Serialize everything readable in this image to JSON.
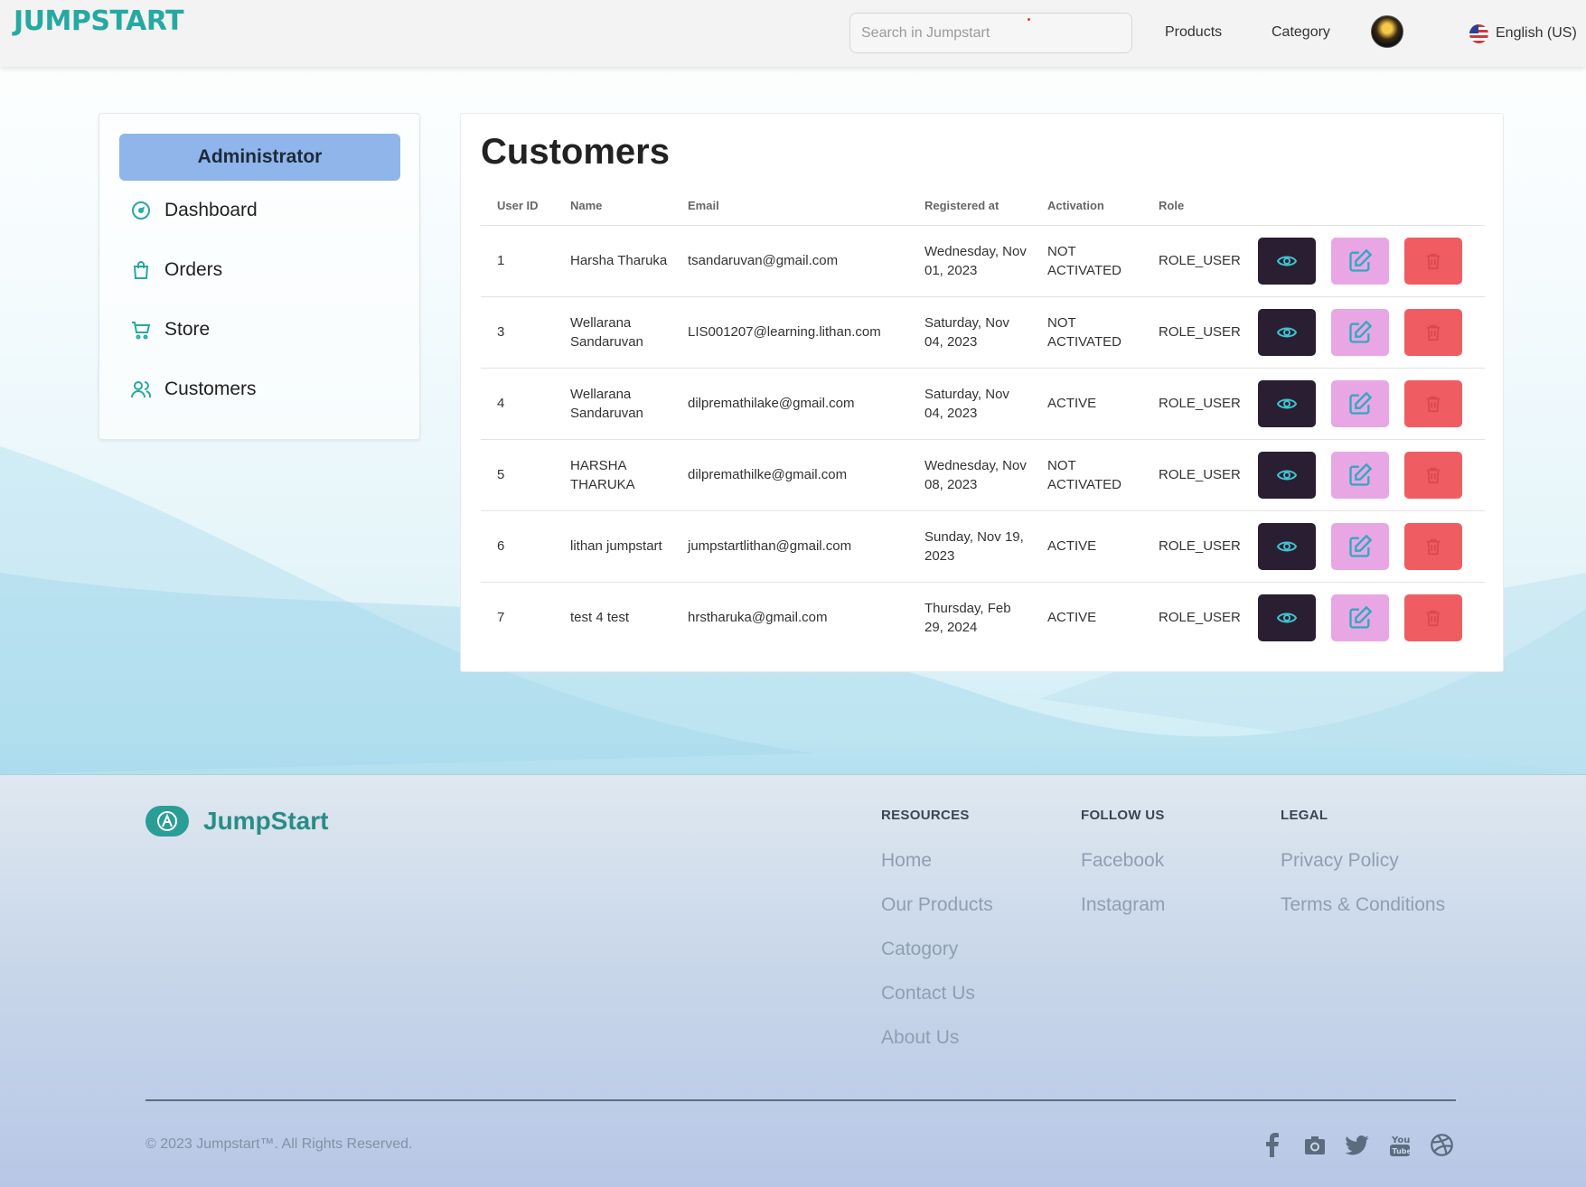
{
  "header": {
    "logo": "JUMPSTART",
    "search_placeholder": "Search in Jumpstart",
    "nav": [
      "Products",
      "Category"
    ],
    "language": "English (US)"
  },
  "sidebar": {
    "title": "Administrator",
    "items": [
      {
        "label": "Dashboard",
        "icon": "dashboard-gauge-icon"
      },
      {
        "label": "Orders",
        "icon": "shopping-bag-icon"
      },
      {
        "label": "Store",
        "icon": "cart-icon"
      },
      {
        "label": "Customers",
        "icon": "users-icon"
      }
    ]
  },
  "customers": {
    "title": "Customers",
    "columns": [
      "User ID",
      "Name",
      "Email",
      "Registered at",
      "Activation",
      "Role"
    ],
    "rows": [
      {
        "id": "1",
        "name": "Harsha Tharuka",
        "email": "tsandaruvan@gmail.com",
        "registered": "Wednesday, Nov 01, 2023",
        "activation": "NOT ACTIVATED",
        "role": "ROLE_USER"
      },
      {
        "id": "3",
        "name": "Wellarana Sandaruvan",
        "email": "LIS001207@learning.lithan.com",
        "registered": "Saturday, Nov 04, 2023",
        "activation": "NOT ACTIVATED",
        "role": "ROLE_USER"
      },
      {
        "id": "4",
        "name": "Wellarana Sandaruvan",
        "email": "dilpremathilake@gmail.com",
        "registered": "Saturday, Nov 04, 2023",
        "activation": "ACTIVE",
        "role": "ROLE_USER"
      },
      {
        "id": "5",
        "name": "HARSHA THARUKA",
        "email": "dilpremathilke@gmail.com",
        "registered": "Wednesday, Nov 08, 2023",
        "activation": "NOT ACTIVATED",
        "role": "ROLE_USER"
      },
      {
        "id": "6",
        "name": "lithan jumpstart",
        "email": "jumpstartlithan@gmail.com",
        "registered": "Sunday, Nov 19, 2023",
        "activation": "ACTIVE",
        "role": "ROLE_USER"
      },
      {
        "id": "7",
        "name": "test 4 test",
        "email": "hrstharuka@gmail.com",
        "registered": "Thursday, Feb 29, 2024",
        "activation": "ACTIVE",
        "role": "ROLE_USER"
      }
    ]
  },
  "footer": {
    "brand": "JumpStart",
    "resources": {
      "heading": "RESOURCES",
      "links": [
        "Home",
        "Our Products",
        "Catogory",
        "Contact Us",
        "About Us"
      ]
    },
    "follow": {
      "heading": "FOLLOW US",
      "links": [
        "Facebook",
        "Instagram"
      ]
    },
    "legal": {
      "heading": "LEGAL",
      "links": [
        "Privacy Policy",
        "Terms & Conditions"
      ]
    },
    "copyright": "© 2023 Jumpstart™. All Rights Reserved.",
    "social_icons": [
      "facebook-icon",
      "instagram-icon",
      "twitter-icon",
      "youtube-icon",
      "dribbble-icon"
    ]
  },
  "colors": {
    "accent": "#26a9a0",
    "admin_button": "#8fb5ea",
    "view_button": "#2a1e33",
    "edit_button": "#e9a6e4",
    "delete_button": "#ef5d62"
  }
}
